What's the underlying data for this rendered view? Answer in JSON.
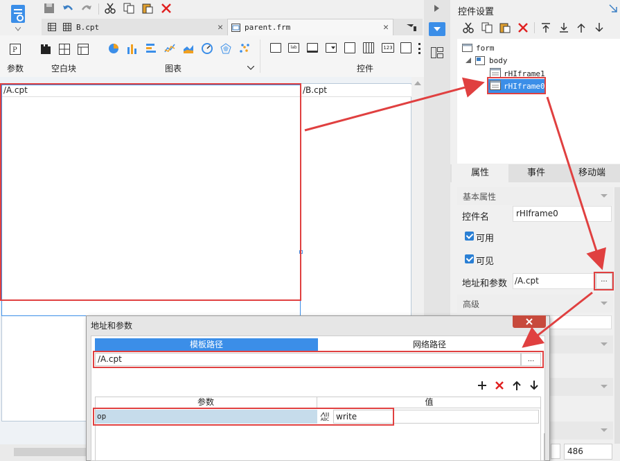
{
  "toolbar": {
    "groups": [
      "参数",
      "空白块",
      "图表",
      "控件"
    ]
  },
  "tabs": [
    {
      "label": "B.cpt"
    },
    {
      "label": "parent.frm"
    }
  ],
  "canvas": {
    "frame_a_label": "/A.cpt",
    "frame_b_label": "/B.cpt"
  },
  "right_panel": {
    "title": "控件设置",
    "tree": [
      "form",
      "body",
      "rHIframe1",
      "rHIframe0"
    ],
    "tabs": [
      "属性",
      "事件",
      "移动端"
    ],
    "sections": [
      "基本属性",
      "高级"
    ],
    "fields": {
      "name_label": "控件名",
      "name_value": "rHIframe0",
      "enabled_label": "可用",
      "visible_label": "可见",
      "url_label": "地址和参数",
      "url_value": "/A.cpt",
      "dots": "..."
    },
    "zoom": "486"
  },
  "dialog": {
    "title": "地址和参数",
    "tab_template": "模板路径",
    "tab_network": "网络路径",
    "path_value": "/A.cpt",
    "dots": "...",
    "col_param": "参数",
    "col_value": "值",
    "row_param": "op",
    "row_value": "write",
    "abc_badge": "ABC"
  },
  "colors": {
    "accent": "#3b8ee8",
    "annotation_red": "#e04040",
    "selection": "#c6dceb"
  }
}
